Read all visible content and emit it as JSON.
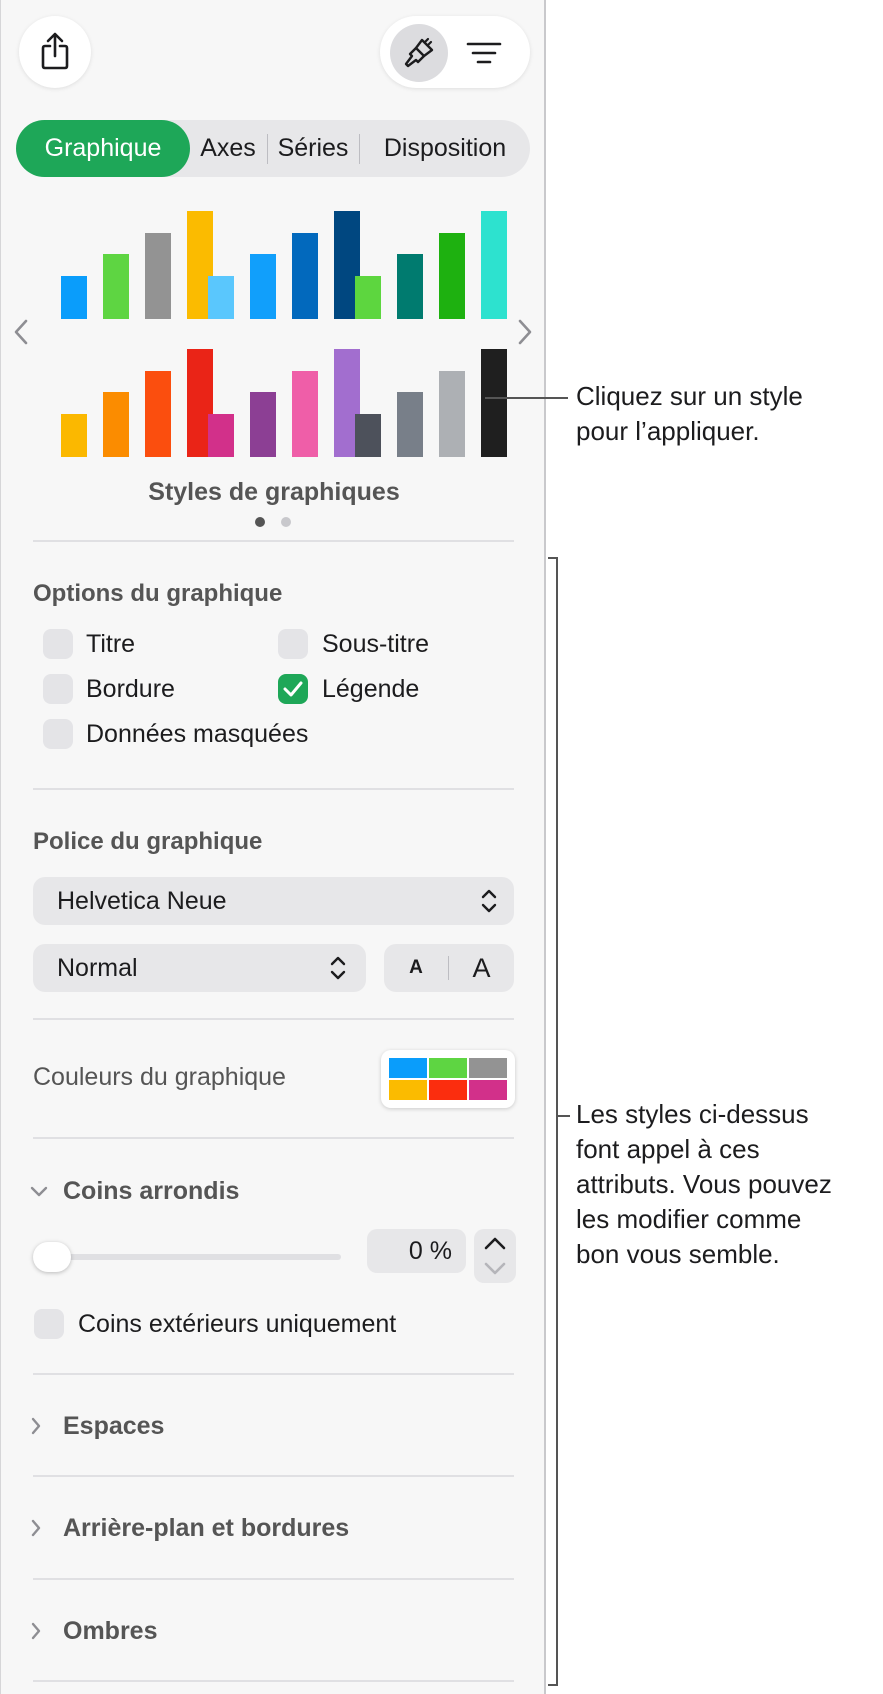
{
  "colors": {
    "accent": "#1ea758",
    "panel_bg": "#f7f7f7",
    "control_bg": "#e7e7e9"
  },
  "toolbar": {
    "share_icon": "share-icon",
    "format_icon": "paintbrush-icon",
    "organize_icon": "list-lines-icon"
  },
  "tabs": [
    {
      "label": "Graphique",
      "active": true
    },
    {
      "label": "Axes",
      "active": false
    },
    {
      "label": "Séries",
      "active": false
    },
    {
      "label": "Disposition",
      "active": false
    }
  ],
  "chart_styles": {
    "title": "Styles de graphiques",
    "page_count": 2,
    "current_page": 1,
    "styles": [
      {
        "bars": [
          {
            "value": 0.4,
            "color": "#0a9dfb"
          },
          {
            "value": 0.6,
            "color": "#5ed542"
          },
          {
            "value": 0.8,
            "color": "#939393"
          },
          {
            "value": 1.0,
            "color": "#fbbb00"
          }
        ]
      },
      {
        "bars": [
          {
            "value": 0.4,
            "color": "#5ac7fd"
          },
          {
            "value": 0.6,
            "color": "#119ffb"
          },
          {
            "value": 0.8,
            "color": "#0269bd"
          },
          {
            "value": 1.0,
            "color": "#004780"
          }
        ]
      },
      {
        "bars": [
          {
            "value": 0.4,
            "color": "#5dd63f"
          },
          {
            "value": 0.6,
            "color": "#007b6f"
          },
          {
            "value": 0.8,
            "color": "#1eb110"
          },
          {
            "value": 1.0,
            "color": "#2de2cf"
          }
        ]
      },
      {
        "bars": [
          {
            "value": 0.4,
            "color": "#fbb800"
          },
          {
            "value": 0.6,
            "color": "#fb8c00"
          },
          {
            "value": 0.8,
            "color": "#fb4e0e"
          },
          {
            "value": 1.0,
            "color": "#ea2417"
          }
        ]
      },
      {
        "bars": [
          {
            "value": 0.4,
            "color": "#d2308a"
          },
          {
            "value": 0.6,
            "color": "#8c3f94"
          },
          {
            "value": 0.8,
            "color": "#ef5ea8"
          },
          {
            "value": 1.0,
            "color": "#a26ecf"
          }
        ]
      },
      {
        "bars": [
          {
            "value": 0.4,
            "color": "#4d515b"
          },
          {
            "value": 0.6,
            "color": "#787f89"
          },
          {
            "value": 0.8,
            "color": "#adb0b4"
          },
          {
            "value": 1.0,
            "color": "#1f1f1f"
          }
        ]
      }
    ]
  },
  "chart_options": {
    "title": "Options du graphique",
    "items": [
      {
        "label": "Titre",
        "checked": false
      },
      {
        "label": "Sous-titre",
        "checked": false
      },
      {
        "label": "Bordure",
        "checked": false
      },
      {
        "label": "Légende",
        "checked": true
      },
      {
        "label": "Données masquées",
        "checked": false
      }
    ]
  },
  "chart_font": {
    "title": "Police du graphique",
    "family": "Helvetica Neue",
    "style": "Normal",
    "smaller_label": "A",
    "larger_label": "A"
  },
  "chart_colors": {
    "label": "Couleurs du graphique",
    "swatches": [
      "#0a9dfb",
      "#5ed542",
      "#939393",
      "#fbbb00",
      "#fb2d0e",
      "#d2308a"
    ]
  },
  "rounded_corners": {
    "title": "Coins arrondis",
    "value": "0 %",
    "slider_fraction": 0,
    "outer_only_label": "Coins extérieurs uniquement",
    "outer_only_checked": false
  },
  "collapsed_sections": [
    {
      "label": "Espaces"
    },
    {
      "label": "Arrière-plan et bordures"
    },
    {
      "label": "Ombres"
    }
  ],
  "callouts": {
    "styles_line1": "Cliquez sur un style",
    "styles_line2": "pour l’appliquer.",
    "attrs_line1": "Les styles ci-dessus",
    "attrs_line2": "font appel à ces",
    "attrs_line3": "attributs. Vous pouvez",
    "attrs_line4": "les modifier comme",
    "attrs_line5": "bon vous semble."
  }
}
